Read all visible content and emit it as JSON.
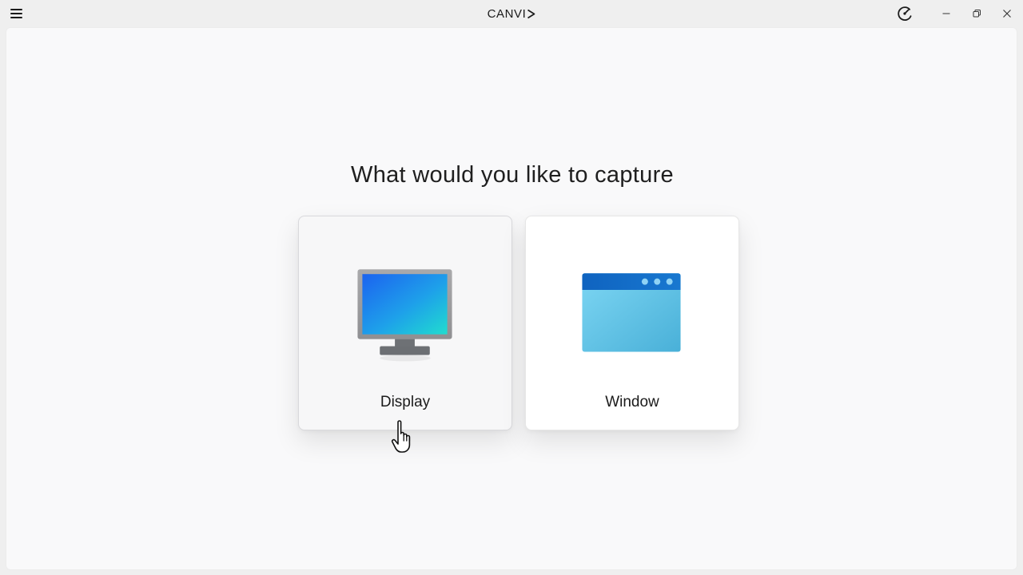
{
  "app": {
    "logo_text": "CANVI",
    "logo_mark": "play-triangle"
  },
  "titlebar": {
    "menu_icon": "hamburger-icon",
    "speed_icon": "speedometer-icon",
    "window_controls": [
      "minimize-icon",
      "restore-icon",
      "close-icon"
    ]
  },
  "main": {
    "heading": "What would you like to capture",
    "options": [
      {
        "label": "Display",
        "icon": "monitor-icon",
        "state": "hovered"
      },
      {
        "label": "Window",
        "icon": "app-window-icon",
        "state": "default"
      }
    ]
  },
  "colors": {
    "background": "#efefef",
    "panel": "#f9f9fa",
    "monitor_screen_start": "#1c6ef2",
    "monitor_screen_end": "#1fd3d6",
    "window_header": "#0f6cc4",
    "window_body": "#5ec6e8"
  }
}
